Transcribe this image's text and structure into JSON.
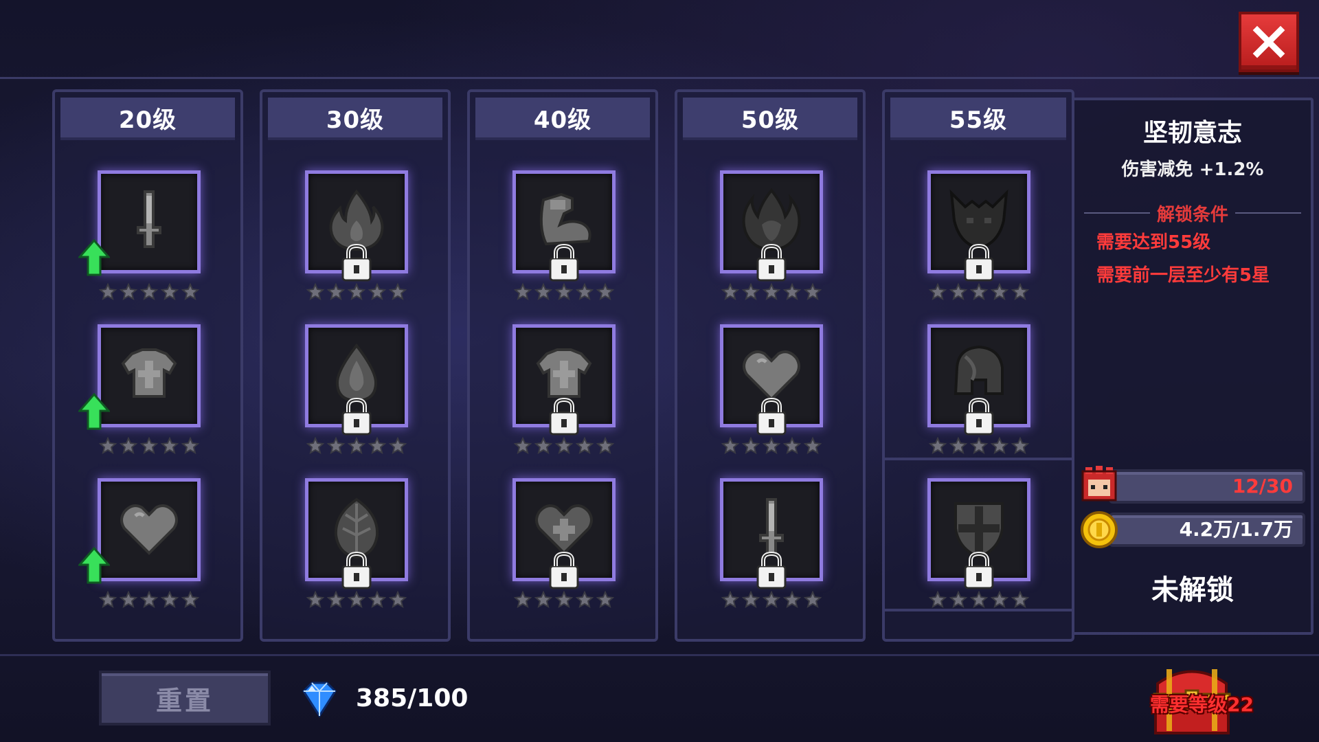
{
  "columns": [
    {
      "label": "20级",
      "skills": [
        {
          "icon": "sword-icon",
          "locked": false,
          "upgradable": true
        },
        {
          "icon": "armor-icon",
          "locked": false,
          "upgradable": true
        },
        {
          "icon": "heart-icon",
          "locked": false,
          "upgradable": true
        }
      ]
    },
    {
      "label": "30级",
      "skills": [
        {
          "icon": "flame-icon",
          "locked": true
        },
        {
          "icon": "drop-icon",
          "locked": true
        },
        {
          "icon": "leaf-icon",
          "locked": true
        }
      ]
    },
    {
      "label": "40级",
      "skills": [
        {
          "icon": "muscle-arm-icon",
          "locked": true
        },
        {
          "icon": "armor-icon",
          "locked": true
        },
        {
          "icon": "heart-plus-icon",
          "locked": true
        }
      ]
    },
    {
      "label": "50级",
      "skills": [
        {
          "icon": "dark-flame-icon",
          "locked": true
        },
        {
          "icon": "heart-icon",
          "locked": true
        },
        {
          "icon": "sword-icon",
          "locked": true
        }
      ]
    },
    {
      "label": "55级",
      "skills": [
        {
          "icon": "demon-icon",
          "locked": true
        },
        {
          "icon": "helmet-icon",
          "locked": true
        },
        {
          "icon": "shield-icon",
          "locked": true
        }
      ]
    }
  ],
  "detail": {
    "title": "坚韧意志",
    "effect": "伤害减免 +1.2%",
    "unlock_header": "解锁条件",
    "conditions": [
      "需要达到55级",
      "需要前一层至少有5星"
    ],
    "fragments": "12/30",
    "gold": "4.2万/1.7万",
    "status": "未解锁"
  },
  "bottom": {
    "reset_label": "重置",
    "gems": "385/100",
    "chest_label": "需要等级22"
  },
  "colors": {
    "slot_border": "#8f7be0",
    "alert_red": "#ff3b3b",
    "arrow_green": "#38e05a"
  }
}
